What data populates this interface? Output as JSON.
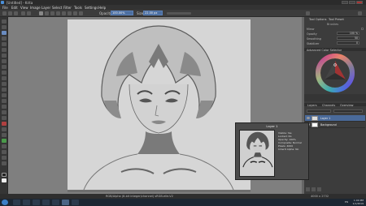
{
  "titlebar": {
    "title": "[Untitled] - Krita",
    "min_label": "",
    "max_label": "",
    "close_label": ""
  },
  "menubar": {
    "items": [
      "File",
      "Edit",
      "View",
      "Image",
      "Layer",
      "Select",
      "Filter",
      "Tools",
      "Settings",
      "Help"
    ]
  },
  "toolbar": {
    "opacity_label": "Opacity:",
    "opacity_value": "100.00%",
    "size_label": "Size:",
    "size_value": "22.00 px"
  },
  "docker": {
    "tabs": [
      "Tool Options",
      "Tool Preset"
    ],
    "section_title": "Brushes",
    "rows": [
      {
        "label": "Mirror",
        "value": ""
      },
      {
        "label": "Opacity",
        "value": "100 %"
      },
      {
        "label": "Smoothing",
        "value": "50"
      },
      {
        "label": "Stabilizer",
        "value": "0"
      }
    ],
    "color_title": "Advanced Color Selector",
    "layers_tabs": [
      "Layers",
      "Channels",
      "Overview"
    ],
    "layers": [
      {
        "name": "Layer 1",
        "selected": true
      },
      {
        "name": "Background",
        "selected": false
      }
    ]
  },
  "tooltip": {
    "title": "Layer 1",
    "lines": [
      "Visible: Yes",
      "Locked: No",
      "Opacity: 100%",
      "Composite: Normal",
      "Pixels: 4000",
      "Inherit Alpha: No"
    ]
  },
  "statusbar": {
    "left": "RGB/Alpha (8-bit integer/channel)  sRGB-elle-V2",
    "right": "4000 x 2732"
  },
  "taskbar": {
    "tray_label": "EN",
    "time": "1:00 PM",
    "date": "1/1/2019"
  },
  "colors": {
    "accent": "#4a6a9a",
    "canvas": "#d6d6d6",
    "workspace": "#7f7f7f"
  }
}
